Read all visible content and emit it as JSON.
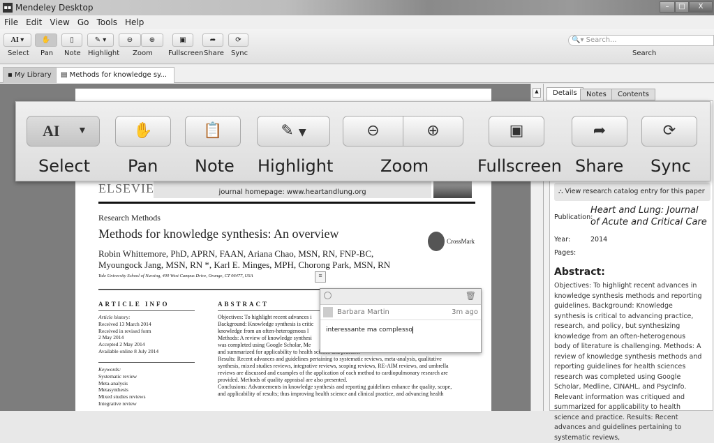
{
  "window": {
    "title": "Mendeley Desktop"
  },
  "menu": [
    "File",
    "Edit",
    "View",
    "Go",
    "Tools",
    "Help"
  ],
  "toolbar": {
    "select": "Select",
    "pan": "Pan",
    "note": "Note",
    "highlight": "Highlight",
    "zoom": "Zoom",
    "fullscreen": "Fullscreen",
    "share": "Share",
    "sync": "Sync",
    "search_placeholder": "Search...",
    "search_label": "Search"
  },
  "tabs": [
    {
      "label": "My Library"
    },
    {
      "label": "Methods for knowledge sy..."
    }
  ],
  "panel_tabs": [
    "Details",
    "Notes",
    "Contents"
  ],
  "document": {
    "publisher": "ELSEVIER",
    "homepage": "journal homepage: www.heartandlung.org",
    "section": "Research Methods",
    "title": "Methods for knowledge synthesis: An overview",
    "crossmark": "CrossMark",
    "authors_1": "Robin Whittemore, PhD, APRN, FAAN, Ariana Chao, MSN, RN, FNP-BC,",
    "authors_2": "Myoungock Jang, MSN, RN *, Karl E. Minges, MPH, Chorong Park, MSN, RN",
    "affiliation": "Yale University School of Nursing, 400 West Campus Drive, Orange, CT 06477, USA",
    "article_info_heading": "ARTICLE INFO",
    "history": [
      "Article history:",
      "Received 13 March 2014",
      "Received in revised form",
      "2 May 2014",
      "Accepted 2 May 2014",
      "Available online 8 July 2014"
    ],
    "keywords": [
      "Keywords:",
      "Systematic review",
      "Meta-analysis",
      "Metasynthesis",
      "Mixed studies reviews",
      "Integrative review"
    ],
    "abstract_heading": "ABSTRACT",
    "abstract_lines": [
      "Objectives: To highlight recent advances i",
      "Background: Knowledge synthesis is critic",
      "knowledge from an often-heterogenous l",
      "Methods: A review of knowledge synthesi",
      "was completed using Google Scholar, Me",
      "and summarized for applicability to health science and practice.",
      "Results: Recent advances and guidelines pertaining to systematic reviews, meta-analysis, qualitative",
      "synthesis, mixed studies reviews, integrative reviews, scoping reviews, RE-AIM reviews, and umbrella",
      "reviews are discussed and examples of the application of each method to cardiopulmonary research are",
      "provided. Methods of quality appraisal are also presented.",
      "Conclusions: Advancements in knowledge synthesis and reporting guidelines enhance the quality, scope,",
      "and applicability of results; thus improving health science and clinical practice, and advancing health"
    ]
  },
  "comment": {
    "author": "Barbara Martin",
    "time": "3m ago",
    "text": "interessante ma complesso"
  },
  "details": {
    "catalog_button": "View research catalog entry for this paper",
    "publication_label": "Publication:",
    "publication": "Heart and Lung: Journal of Acute and Critical Care",
    "year_label": "Year:",
    "year": "2014",
    "pages_label": "Pages:",
    "abstract_label": "Abstract:",
    "abstract": "Objectives: To highlight recent advances in knowledge synthesis methods and reporting guidelines. Background: Knowledge synthesis is critical to advancing practice, research, and policy, but synthesizing knowledge from an often-heterogenous body of literature is challenging. Methods: A review of knowledge synthesis methods and reporting guidelines for health sciences research was completed using Google Scholar, Medline, CINAHL, and PsycInfo. Relevant information was critiqued and summarized for applicability to health science and practice. Results: Recent advances and guidelines pertaining to systematic reviews,"
  },
  "icons": [
    "mendeley-logo-icon",
    "select-text-icon",
    "pan-hand-icon",
    "note-icon",
    "highlight-icon",
    "zoom-out-icon",
    "zoom-in-icon",
    "fullscreen-icon",
    "share-icon",
    "sync-icon",
    "search-icon",
    "close-tab-icon",
    "trash-icon",
    "avatar"
  ]
}
